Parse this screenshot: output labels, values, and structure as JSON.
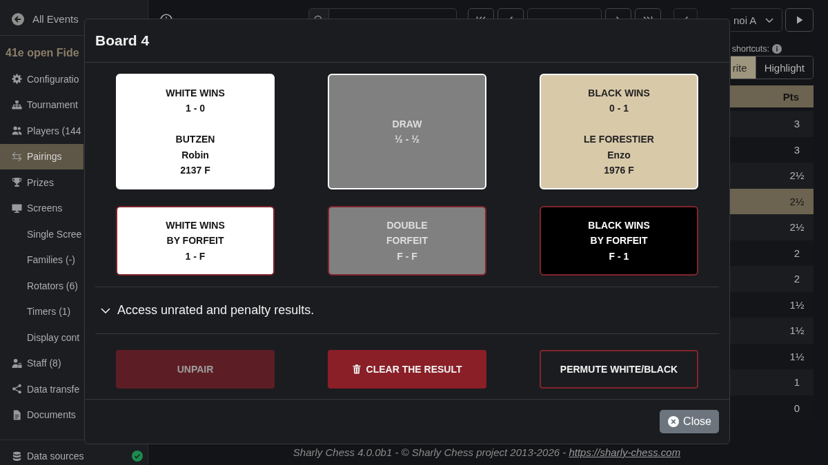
{
  "sidebar": {
    "back_link": "All Events",
    "event_title": "41e open Fide",
    "items": [
      {
        "label": "Configuratio",
        "selected": false
      },
      {
        "label": "Tournament",
        "selected": false
      },
      {
        "label": "Players (144",
        "selected": false
      },
      {
        "label": "Pairings",
        "selected": true
      },
      {
        "label": "Prizes",
        "selected": false
      },
      {
        "label": "Screens",
        "selected": false,
        "children": [
          {
            "label": "Single Scree",
            "selected": false
          },
          {
            "label": "Families (-)",
            "selected": false
          },
          {
            "label": "Rotators (6)",
            "selected": false
          },
          {
            "label": "Timers (1)",
            "selected": false
          },
          {
            "label": "Display cont",
            "selected": false
          }
        ]
      },
      {
        "label": "Staff (8)",
        "selected": false
      },
      {
        "label": "Data transfe",
        "selected": false
      },
      {
        "label": "Documents",
        "selected": false
      }
    ],
    "data_sources": {
      "label": "Data sources",
      "ok": true
    }
  },
  "toolbar": {
    "tournament": "noi A"
  },
  "shortcuts": {
    "label": "shortcuts:",
    "modes": [
      {
        "label": "rite",
        "selected": true
      },
      {
        "label": "Highlight",
        "selected": false
      }
    ]
  },
  "table": {
    "columns": [
      "Pts"
    ],
    "rows": [
      {
        "pts": "3",
        "selected": false
      },
      {
        "pts": "3",
        "selected": false
      },
      {
        "pts": "2½",
        "selected": false
      },
      {
        "pts": "2½",
        "selected": true
      },
      {
        "pts": "2½",
        "selected": false
      },
      {
        "pts": "2",
        "selected": false
      },
      {
        "pts": "2",
        "selected": false
      },
      {
        "pts": "1½",
        "selected": false
      },
      {
        "pts": "1½",
        "selected": false
      },
      {
        "pts": "1½",
        "selected": false
      },
      {
        "pts": "1",
        "selected": false
      },
      {
        "pts": "0",
        "selected": false
      }
    ]
  },
  "modal": {
    "title": "Board 4",
    "results": [
      {
        "kind": "white",
        "forfeit": false,
        "lines": [
          "WHITE WINS",
          "1 - 0"
        ],
        "player": [
          "BUTZEN",
          "Robin",
          "2137 F"
        ]
      },
      {
        "kind": "draw",
        "forfeit": false,
        "lines": [
          "DRAW",
          "½ - ½"
        ]
      },
      {
        "kind": "black",
        "forfeit": false,
        "lines": [
          "BLACK WINS",
          "0 - 1"
        ],
        "player": [
          "LE FORESTIER",
          "Enzo",
          "1976 F"
        ]
      },
      {
        "kind": "white",
        "forfeit": true,
        "lines": [
          "WHITE WINS",
          "BY FORFEIT",
          "1 - F"
        ]
      },
      {
        "kind": "draw",
        "forfeit": true,
        "lines": [
          "DOUBLE",
          "FORFEIT",
          "F - F"
        ]
      },
      {
        "kind": "black",
        "forfeit": true,
        "lines": [
          "BLACK WINS",
          "BY FORFEIT",
          "F - 1"
        ]
      }
    ],
    "more_results": {
      "label": "Access unrated and penalty results.",
      "expanded": false
    },
    "actions": [
      {
        "kind": "unpair",
        "label": "UNPAIR",
        "disabled": true
      },
      {
        "kind": "clear",
        "label": "CLEAR THE RESULT",
        "disabled": false
      },
      {
        "kind": "permute",
        "label": "PERMUTE WHITE/BLACK",
        "disabled": false
      }
    ],
    "close": "Close"
  },
  "footer": {
    "text": "Sharly Chess 4.0.0b1 - © Sharly Chess project 2013-2026 -",
    "link": "https://sharly-chess.com"
  }
}
